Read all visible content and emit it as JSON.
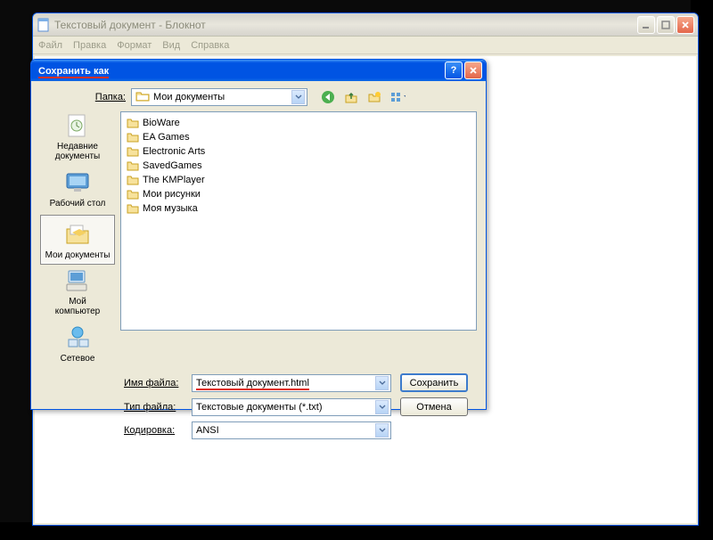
{
  "notepad": {
    "title": "Текстовый документ - Блокнот",
    "menu": {
      "file": "Файл",
      "edit": "Правка",
      "format": "Формат",
      "view": "Вид",
      "help": "Справка"
    }
  },
  "dialog": {
    "title": "Сохранить как",
    "folder_label": "Папка:",
    "folder_value": "Мои документы",
    "places": {
      "recent": "Недавние\nдокументы",
      "desktop": "Рабочий стол",
      "mydocs": "Мои документы",
      "mycomp": "Мой\nкомпьютер",
      "network": "Сетевое"
    },
    "files": [
      "BioWare",
      "EA Games",
      "Electronic Arts",
      "SavedGames",
      "The KMPlayer",
      "Мои рисунки",
      "Моя музыка"
    ],
    "filename_label": "Имя файла:",
    "filename_value": "Текстовый документ.html",
    "filetype_label": "Тип файла:",
    "filetype_value": "Текстовые документы (*.txt)",
    "encoding_label": "Кодировка:",
    "encoding_value": "ANSI",
    "save_btn": "Сохранить",
    "cancel_btn": "Отмена"
  }
}
